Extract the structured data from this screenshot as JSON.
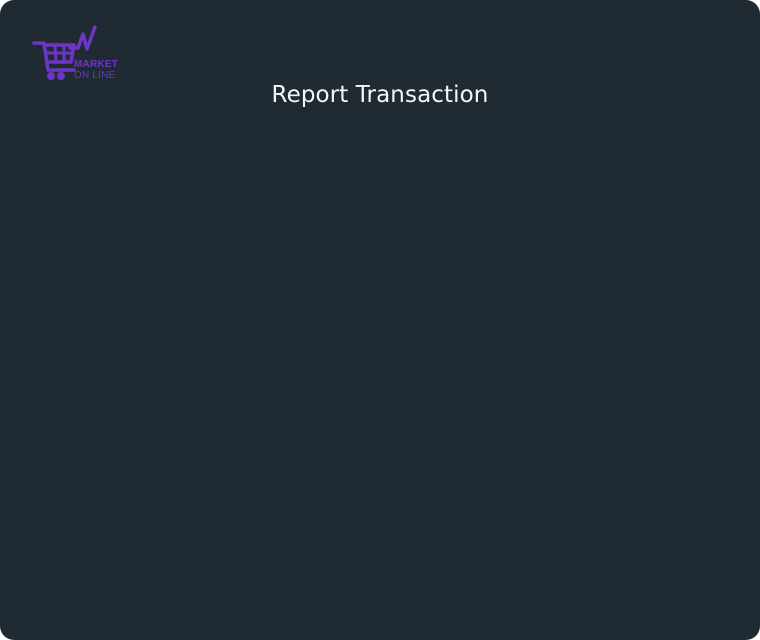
{
  "app": {
    "logo": {
      "line1": "MARKET",
      "line2": "ON LINE",
      "icon": "shopping-cart-chart-icon",
      "color": "#6d35c6"
    },
    "title": "Report Transaction"
  },
  "colors": {
    "background": "#202a33",
    "title": "#f4f6f8",
    "accent": "#6d35c6"
  }
}
